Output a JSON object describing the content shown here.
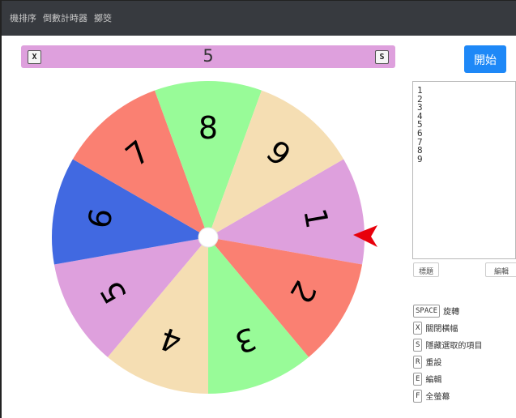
{
  "nav": {
    "items": [
      "機排序",
      "倒數計時器",
      "擲筊"
    ]
  },
  "banner": {
    "close_key": "X",
    "value": "5",
    "hide_key": "S",
    "color": "#dea0dd"
  },
  "wheel": {
    "segments": [
      {
        "label": "1",
        "color": "#dea0dd"
      },
      {
        "label": "2",
        "color": "#fa8072"
      },
      {
        "label": "3",
        "color": "#98fb98"
      },
      {
        "label": "4",
        "color": "#f5deb3"
      },
      {
        "label": "5",
        "color": "#dea0dd"
      },
      {
        "label": "6",
        "color": "#4169e1"
      },
      {
        "label": "7",
        "color": "#fa8072"
      },
      {
        "label": "8",
        "color": "#98fb98"
      },
      {
        "label": "9",
        "color": "#f5deb3"
      }
    ],
    "pointer_color": "#e8000b",
    "pointer_icon": "red-triangle-pointer-icon"
  },
  "start_button": {
    "label": "開始",
    "color": "#1e88f7"
  },
  "items_list": [
    "1",
    "2",
    "3",
    "4",
    "5",
    "6",
    "7",
    "8",
    "9"
  ],
  "buttons": {
    "title": "標題",
    "edit": "編輯"
  },
  "shortcuts": [
    {
      "key": "SPACE",
      "desc": "旋轉"
    },
    {
      "key": "X",
      "desc": "關閉橫幅"
    },
    {
      "key": "S",
      "desc": "隱藏選取的項目"
    },
    {
      "key": "R",
      "desc": "重設"
    },
    {
      "key": "E",
      "desc": "編輯"
    },
    {
      "key": "F",
      "desc": "全螢幕"
    }
  ]
}
